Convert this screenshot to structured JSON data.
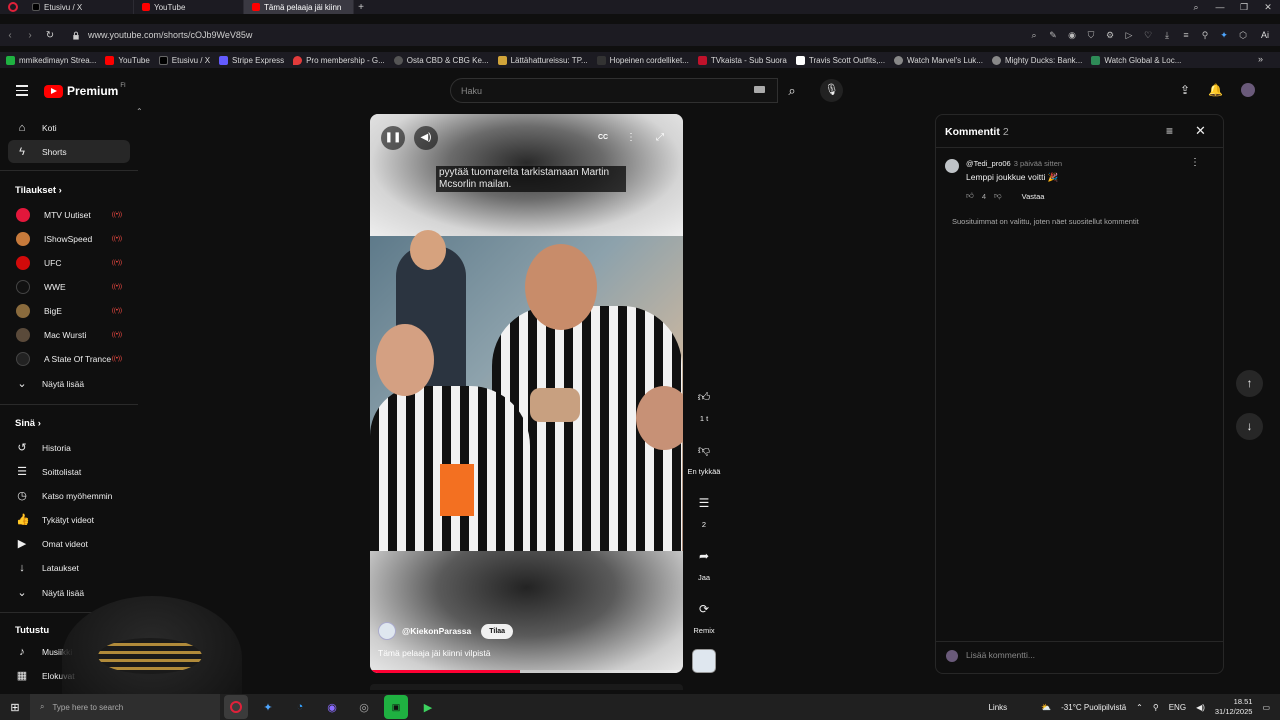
{
  "browser": {
    "tabs": [
      {
        "label": "Etusivu / X"
      },
      {
        "label": "YouTube"
      },
      {
        "label": "Tämä pelaaja jäi kiinn",
        "active": true
      }
    ],
    "new_tab": "+",
    "url": "www.youtube.com/shorts/cOJb9WeV85w",
    "nav_back": "‹",
    "nav_forward": "›",
    "reload": "↻",
    "ai_label": "Ai",
    "bookmarks": [
      {
        "label": "mmikedimayn Strea...",
        "color": "#1fb141"
      },
      {
        "label": "YouTube",
        "color": "#ff0000"
      },
      {
        "label": "Etusivu / X",
        "color": "#000000"
      },
      {
        "label": "Stripe Express",
        "color": "#635bff"
      },
      {
        "label": "Pro membership - G...",
        "color": "#e23b3b"
      },
      {
        "label": "Osta CBD & CBG Ke...",
        "color": "#555555"
      },
      {
        "label": "Lättähattureissu: TP...",
        "color": "#d1a43a"
      },
      {
        "label": "Hopeinen cordelliket...",
        "color": "#333333"
      },
      {
        "label": "TVkaista - Sub Suora",
        "color": "#c0122b"
      },
      {
        "label": "Travis Scott Outfits,...",
        "color": "#ffffff"
      },
      {
        "label": "Watch Marvel's Luk...",
        "color": "#888888"
      },
      {
        "label": "Mighty Ducks: Bank...",
        "color": "#888888"
      },
      {
        "label": "Watch Global & Loc...",
        "color": "#2e8b57"
      }
    ]
  },
  "youtube": {
    "logo_text": "Premium",
    "logo_sup": "FI",
    "search_placeholder": "Haku"
  },
  "sidebar": {
    "main": [
      {
        "label": "Koti",
        "icon": "⌂"
      },
      {
        "label": "Shorts",
        "icon": "ϟ",
        "active": true
      }
    ],
    "subscriptions_header": "Tilaukset",
    "subscriptions": [
      {
        "label": "MTV Uutiset",
        "color": "#e3173b"
      },
      {
        "label": "IShowSpeed",
        "color": "#c77a3b"
      },
      {
        "label": "UFC",
        "color": "#d20a0a"
      },
      {
        "label": "WWE",
        "color": "#111111"
      },
      {
        "label": "BigE",
        "color": "#8a6b3d"
      },
      {
        "label": "Mac Wursti",
        "color": "#5a4a3a"
      },
      {
        "label": "A State Of Trance",
        "color": "#222222"
      }
    ],
    "show_more_1": "Näytä lisää",
    "you_header": "Sinä",
    "you": [
      {
        "label": "Historia",
        "icon": "↺"
      },
      {
        "label": "Soittolistat",
        "icon": "☰"
      },
      {
        "label": "Katso myöhemmin",
        "icon": "◷"
      },
      {
        "label": "Tykätyt videot",
        "icon": "👍"
      },
      {
        "label": "Omat videot",
        "icon": "▶"
      },
      {
        "label": "Lataukset",
        "icon": "↓"
      }
    ],
    "show_more_2": "Näytä lisää",
    "explore_header": "Tutustu",
    "explore": [
      {
        "label": "Musiikki",
        "icon": "♪"
      },
      {
        "label": "Elokuvat",
        "icon": "▦"
      }
    ]
  },
  "video": {
    "caption": "pyytää tuomareita tarkistamaan Martin Mcsorlin mailan.",
    "channel": "@KiekonParassa",
    "subscribe": "Tilaa",
    "title": "Tämä pelaaja jäi kiinni vilpistä",
    "progress": 0.48,
    "cc_label": "CC"
  },
  "actions": {
    "like_count": "1 t",
    "dislike_label": "En tykkää",
    "comments_count": "2",
    "share_label": "Jaa",
    "remix_label": "Remix"
  },
  "comments": {
    "title": "Kommentit",
    "count": "2",
    "items": [
      {
        "author": "@Tedi_pro06",
        "time": "3 päivää sitten",
        "text": "Lemppi joukkue voitti 🎉",
        "likes": "4",
        "reply": "Vastaa"
      }
    ],
    "note": "Suosituimmat on valittu, joten näet suositellut kommentit",
    "add_placeholder": "Lisää kommentti..."
  },
  "taskbar": {
    "search_text": "Type here to search",
    "links": "Links",
    "weather": "-31°C Puolipilvistä",
    "lang": "ENG",
    "time": "18.51",
    "date": "31/12/2025"
  }
}
